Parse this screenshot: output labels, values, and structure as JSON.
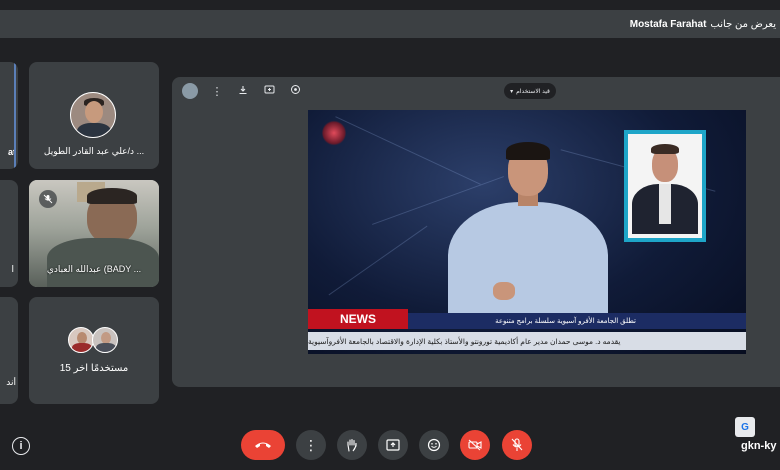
{
  "presenter_bar": {
    "name": "Mostafa Farahat",
    "suffix": "يعرض من جانب"
  },
  "participants": [
    {
      "label": "د/علي عبد القادر الطويل ...",
      "mic": "on"
    },
    {
      "label": "عبدالله العبادي (BADY ...",
      "mic": "muted"
    },
    {
      "label": "15 مستخدمًا آخر"
    }
  ],
  "edge_tiles": [
    {
      "label": "at"
    },
    {
      "label": "ا"
    },
    {
      "label": "أند"
    }
  ],
  "presentation": {
    "pill_label": "قيد الاستخدام",
    "news_tag": "NEWS",
    "ticker_line_1": "تطلق الجامعة الأفرو آسيوية سلسلة برامج متنوعة",
    "ticker_line_2": "يقدمه د. موسى حمدان مدير عام أكاديمية تورونتو والأستاذ بكلية الإدارة والاقتصاد بالجامعة الأفروآسيوية"
  },
  "toolbar": {
    "buttons": [
      "end-call",
      "more-options",
      "raise-hand",
      "present-screen",
      "reactions",
      "camera-off",
      "mic-off"
    ]
  },
  "meeting_code": "gkn-ky",
  "colors": {
    "background": "#202124",
    "surface": "#3c4043",
    "danger": "#ea4335",
    "news_red": "#c1121f",
    "ticker_blue": "#1c2c63"
  }
}
